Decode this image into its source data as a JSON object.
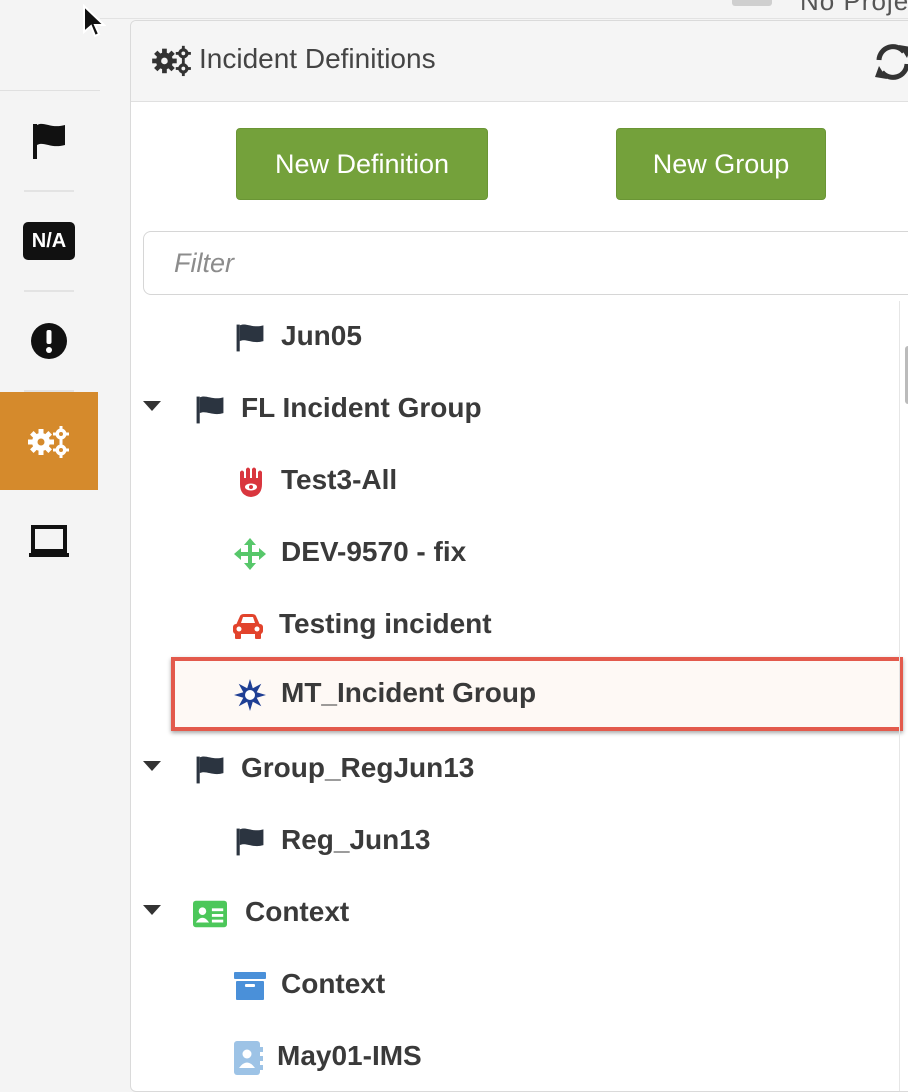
{
  "top_bar": {
    "project_text": "No Proje"
  },
  "sidebar": {
    "items": [
      {
        "name": "flag-icon",
        "active": false
      },
      {
        "name": "na-icon",
        "text": "N/A",
        "active": false
      },
      {
        "name": "exclamation-icon",
        "active": false
      },
      {
        "name": "gears-icon",
        "active": true
      },
      {
        "name": "laptop-icon",
        "active": false
      }
    ]
  },
  "panel": {
    "title": "Incident Definitions",
    "new_definition_label": "New Definition",
    "new_group_label": "New Group",
    "filter_placeholder": "Filter"
  },
  "tree": {
    "rows": [
      {
        "label": "Jun05",
        "level": "child",
        "icon": "flag-icon"
      },
      {
        "label": "FL Incident Group",
        "level": "group",
        "icon": "flag-icon",
        "expanded": true
      },
      {
        "label": "Test3-All",
        "level": "child",
        "icon": "hamsa-icon",
        "color": "#d9363e"
      },
      {
        "label": "DEV-9570 - fix",
        "level": "child",
        "icon": "move-arrows-icon",
        "color": "#57c76a"
      },
      {
        "label": "Testing incident",
        "level": "child",
        "icon": "car-icon",
        "color": "#e2432c"
      },
      {
        "label": "MT_Incident Group",
        "level": "child",
        "icon": "starburst-icon",
        "color": "#1f3f94",
        "selected": true
      },
      {
        "label": "Group_RegJun13",
        "level": "group",
        "icon": "flag-icon",
        "expanded": true
      },
      {
        "label": "Reg_Jun13",
        "level": "child",
        "icon": "flag-icon"
      },
      {
        "label": "Context",
        "level": "group",
        "icon": "id-card-icon",
        "color": "#4cc75a",
        "expanded": true
      },
      {
        "label": "Context",
        "level": "child",
        "icon": "archive-icon",
        "color": "#4a90d9"
      },
      {
        "label": "May01-IMS",
        "level": "child",
        "icon": "address-book-icon",
        "color": "#9dc3e6"
      }
    ]
  },
  "colors": {
    "accent_button": "#74a13b",
    "sidebar_active": "#d58a2c",
    "selection_border": "#e35a4c"
  }
}
